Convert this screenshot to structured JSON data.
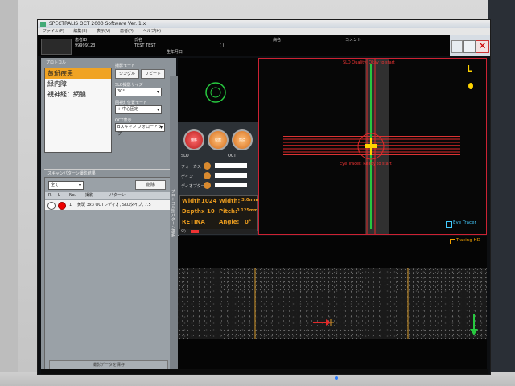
{
  "window": {
    "title": "SPECTRALIS OCT 2000 Software Ver. 1.x",
    "menu": [
      "ファイル(F)",
      "編集(E)",
      "表示(V)",
      "患者(P)",
      "ヘルプ(H)"
    ]
  },
  "patient": {
    "id_label": "患者ID",
    "id_value": "99999123",
    "name_label": "氏名",
    "name_value": "TEST TEST",
    "birth_label": "生年月日",
    "sex_label": "性別",
    "sex_value": "(  )",
    "disease_label": "病名",
    "comment_label": "コメント"
  },
  "protocol": {
    "title": "プロトコル",
    "items": [
      "黄斑疾患",
      "緑内障",
      "視神経：網膜"
    ],
    "selected_index": 0
  },
  "scan_mode": {
    "title": "撮影モード",
    "single_label": "シングル",
    "repeat_label": "リピート",
    "slo_size_title": "SLO撮影サイズ",
    "slo_size_value": "30°",
    "fixation_title": "固視灯位置モード",
    "fixation_value": "+ 中心固定",
    "oct_title": "OCT表示",
    "oct_value": "Bスキャン フォローアップ"
  },
  "data_list": {
    "title": "スキャンパターン撮影結果",
    "filter_value": "全て",
    "delete_label": "削除",
    "columns": [
      "R",
      "L",
      "No.",
      "撮影",
      "パターン"
    ],
    "rows": [
      {
        "no": "1",
        "text": "黄斑 3x3 OCTレディオ, SLOタイプ, 7.5"
      }
    ],
    "footer_button": "撮影データを保存"
  },
  "side_tab": "プロトコル別パターン選択",
  "buttons": {
    "capture": "撮影",
    "align": "位置",
    "focus": "焦点"
  },
  "params": {
    "header1": "SLO",
    "header2": "OCT",
    "rows": [
      {
        "label": "フォーカス",
        "value": "0"
      },
      {
        "label": "ゲイン",
        "value": "0"
      },
      {
        "label": "ディオプター",
        "value": "0"
      }
    ],
    "width_label": "Width",
    "width_value": "1024",
    "width_mm_label": "Width:",
    "width_mm_value": "3.0mm",
    "depth_label": "Depth",
    "depth_value": "x 10",
    "pitch_label": "Pitch:",
    "pitch_value": "0.125mm",
    "retina_label": "RETINA",
    "angle_label": "Angle:",
    "angle_value": "0°",
    "signal_label": "SQ"
  },
  "slo_view": {
    "top_text": "SLO Quality: Okay to start",
    "bottom_text": "Eye Tracer: Ready to start",
    "eye_label": "L",
    "tracer_label": "Eye Tracer",
    "tracer_checked": true
  },
  "oct_view": {
    "tracking_label": "Tracing HD",
    "tracking_checked": true
  },
  "colors": {
    "accent_orange": "#f0a323",
    "red_line": "#e02a2a",
    "green_line": "#27c93f",
    "yellow_marker": "#ffd400",
    "panel_gray": "#8c9399"
  }
}
